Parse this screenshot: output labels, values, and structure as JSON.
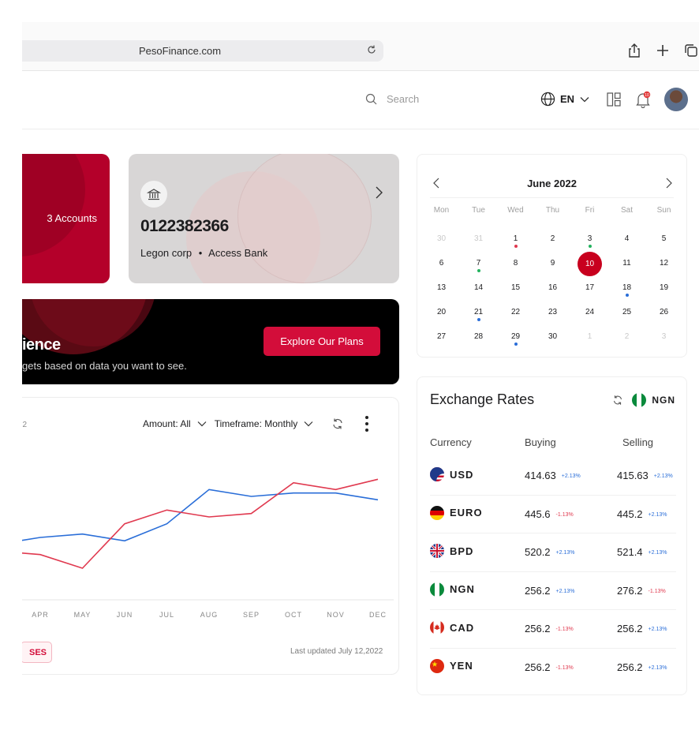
{
  "browser": {
    "url": "PesoFinance.com"
  },
  "header": {
    "search_placeholder": "Search",
    "language": "EN",
    "notification_count": "10"
  },
  "accounts_card": {
    "label": "3 Accounts",
    "color": "#b4002a"
  },
  "bank_card": {
    "account_number": "0122382366",
    "account_name": "Legon corp",
    "separator": "•",
    "bank_name": "Access Bank"
  },
  "banner": {
    "title_fragment": "ience",
    "subtitle_fragment": "gets based on data you want to see.",
    "button_label": "Explore Our Plans",
    "accent": "#d30d3a"
  },
  "chart": {
    "date_fragment": "22",
    "amount_filter": "Amount: All",
    "timeframe_filter": "Timeframe: Monthly",
    "tag_fragment": "SES",
    "last_updated": "Last updated July 12,2022"
  },
  "chart_data": {
    "type": "line",
    "categories": [
      "APR",
      "MAY",
      "JUN",
      "JUL",
      "AUG",
      "SEP",
      "OCT",
      "NOV",
      "DEC"
    ],
    "series": [
      {
        "color": "#2a6ed8",
        "values": [
          18,
          19,
          17,
          22,
          32,
          30,
          31,
          31,
          29
        ]
      },
      {
        "color": "#e0394f",
        "values": [
          13,
          9,
          22,
          26,
          24,
          25,
          34,
          32,
          35
        ]
      }
    ],
    "ylim": [
      0,
      45
    ],
    "grid": false
  },
  "calendar": {
    "title": "June 2022",
    "weekdays": [
      "Mon",
      "Tue",
      "Wed",
      "Thu",
      "Fri",
      "Sat",
      "Sun"
    ],
    "weeks": [
      [
        {
          "d": "30",
          "m": true
        },
        {
          "d": "31",
          "m": true
        },
        {
          "d": "1",
          "dot": "#e0394f"
        },
        {
          "d": "2"
        },
        {
          "d": "3",
          "dot": "#22b35e"
        },
        {
          "d": "4"
        },
        {
          "d": "5"
        }
      ],
      [
        {
          "d": "6"
        },
        {
          "d": "7",
          "dot": "#22b35e"
        },
        {
          "d": "8"
        },
        {
          "d": "9"
        },
        {
          "d": "10",
          "sel": true
        },
        {
          "d": "11"
        },
        {
          "d": "12"
        }
      ],
      [
        {
          "d": "13"
        },
        {
          "d": "14"
        },
        {
          "d": "15"
        },
        {
          "d": "16"
        },
        {
          "d": "17"
        },
        {
          "d": "18",
          "dot": "#2a6ed8"
        },
        {
          "d": "19"
        }
      ],
      [
        {
          "d": "20"
        },
        {
          "d": "21",
          "dot": "#2a6ed8"
        },
        {
          "d": "22"
        },
        {
          "d": "23"
        },
        {
          "d": "24"
        },
        {
          "d": "25"
        },
        {
          "d": "26"
        }
      ],
      [
        {
          "d": "27"
        },
        {
          "d": "28"
        },
        {
          "d": "29",
          "dot": "#2a6ed8"
        },
        {
          "d": "30"
        },
        {
          "d": "1",
          "m": true
        },
        {
          "d": "2",
          "m": true
        },
        {
          "d": "3",
          "m": true
        }
      ]
    ]
  },
  "rates": {
    "title": "Exchange Rates",
    "base_currency": "NGN",
    "columns": {
      "currency": "Currency",
      "buying": "Buying",
      "selling": "Selling"
    },
    "rows": [
      {
        "code": "USD",
        "flag": "us-flag-icon",
        "buy": "414.63",
        "buy_chg": "+2.13%",
        "buy_dir": "up",
        "sell": "415.63",
        "sell_chg": "+2.13%",
        "sell_dir": "up"
      },
      {
        "code": "EURO",
        "flag": "germany-flag-icon",
        "buy": "445.6",
        "buy_chg": "-1.13%",
        "buy_dir": "down",
        "sell": "445.2",
        "sell_chg": "+2.13%",
        "sell_dir": "up"
      },
      {
        "code": "BPD",
        "flag": "uk-flag-icon",
        "buy": "520.2",
        "buy_chg": "+2.13%",
        "buy_dir": "up",
        "sell": "521.4",
        "sell_chg": "+2.13%",
        "sell_dir": "up"
      },
      {
        "code": "NGN",
        "flag": "nigeria-flag-icon",
        "buy": "256.2",
        "buy_chg": "+2.13%",
        "buy_dir": "up",
        "sell": "276.2",
        "sell_chg": "-1.13%",
        "sell_dir": "down"
      },
      {
        "code": "CAD",
        "flag": "canada-flag-icon",
        "buy": "256.2",
        "buy_chg": "-1.13%",
        "buy_dir": "down",
        "sell": "256.2",
        "sell_chg": "+2.13%",
        "sell_dir": "up"
      },
      {
        "code": "YEN",
        "flag": "china-flag-icon",
        "buy": "256.2",
        "buy_chg": "-1.13%",
        "buy_dir": "down",
        "sell": "256.2",
        "sell_chg": "+2.13%",
        "sell_dir": "up"
      }
    ]
  }
}
